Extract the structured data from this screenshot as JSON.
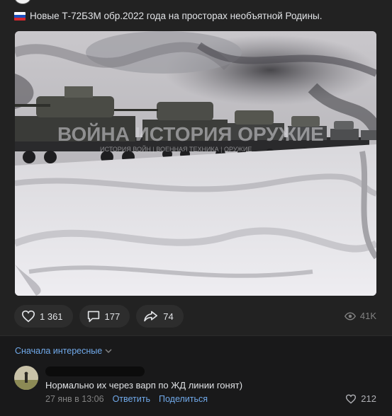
{
  "post": {
    "text": "Новые Т-72Б3М обр.2022 года на просторах необъятной Родины.",
    "flag_icon": "russia-flag-icon",
    "flag_colors": [
      "#ffffff",
      "#1c4fbf",
      "#d7282f"
    ],
    "media": {
      "watermark_line1": "ВОЙНА ИСТОРИЯ ОРУЖИЕ",
      "watermark_line2": "ИСТОРИЯ ВОЙН | ВОЕННАЯ ТЕХНИКА | ОРУЖИЕ"
    },
    "actions": {
      "likes": "1 361",
      "comments": "177",
      "shares": "74"
    },
    "views": "41K"
  },
  "comments": {
    "sort_label": "Сначала интересные",
    "items": [
      {
        "text": "Нормально их через варп по ЖД линии гонят)",
        "date": "27 янв в 13:06",
        "reply_label": "Ответить",
        "share_label": "Поделиться",
        "likes": "212"
      }
    ]
  },
  "colors": {
    "background": "#222222",
    "link": "#71aaeb",
    "muted": "#828282",
    "pill": "#2d2d2d"
  }
}
